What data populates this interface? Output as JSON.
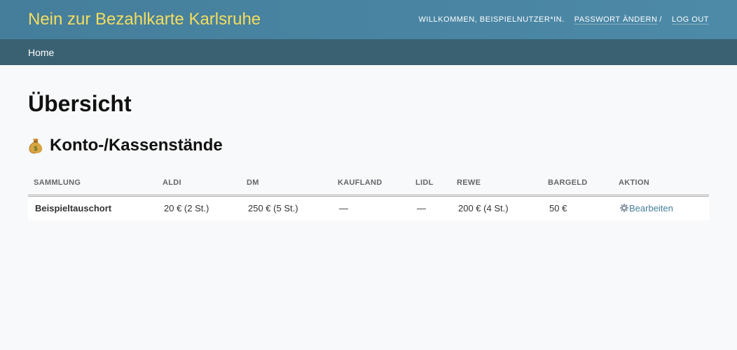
{
  "header": {
    "branding": "Nein zur Bezahlkarte Karlsruhe",
    "welcome": "Willkommen,",
    "username": "Beispielnutzer*in",
    "change_password": "Passwort ändern",
    "separator": "/",
    "logout": "Log out"
  },
  "breadcrumbs": {
    "home": "Home"
  },
  "main": {
    "title": "Übersicht",
    "section_icon": "money-bag-icon",
    "section_title": "Konto-/Kassenstände"
  },
  "table": {
    "columns": [
      "Sammlung",
      "Aldi",
      "DM",
      "Kaufland",
      "Lidl",
      "Rewe",
      "Bargeld",
      "Aktion"
    ],
    "rows": [
      {
        "sammlung": "Beispieltauschort",
        "aldi": "20 € (2 St.)",
        "dm": "250 € (5 St.)",
        "kaufland": "—",
        "lidl": "—",
        "rewe": "200 € (4 St.)",
        "bargeld": "50 €",
        "aktion": "Bearbeiten"
      }
    ]
  },
  "colors": {
    "header_bg": "#4d8aa8",
    "breadcrumb_bg": "#396172",
    "branding": "#f5dd5d",
    "link": "#447e9b"
  }
}
